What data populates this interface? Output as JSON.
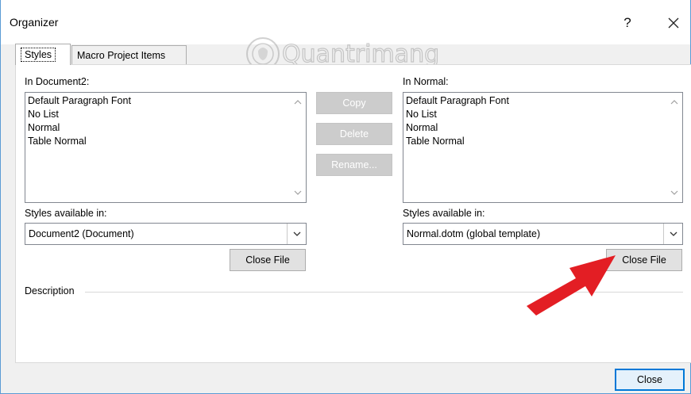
{
  "window": {
    "title": "Organizer",
    "help_glyph": "?",
    "close_glyph": "✕"
  },
  "tabs": [
    {
      "label": "Styles",
      "active": true
    },
    {
      "label": "Macro Project Items",
      "active": false
    }
  ],
  "left": {
    "label": "In Document2:",
    "items": [
      "Default Paragraph Font",
      "No List",
      "Normal",
      "Table Normal"
    ],
    "available_label": "Styles available in:",
    "available_value": "Document2 (Document)",
    "close_file_label": "Close File"
  },
  "right": {
    "label": "In Normal:",
    "items": [
      "Default Paragraph Font",
      "No List",
      "Normal",
      "Table Normal"
    ],
    "available_label": "Styles available in:",
    "available_value": "Normal.dotm (global template)",
    "close_file_label": "Close File"
  },
  "actions": {
    "copy_label": "Copy",
    "delete_label": "Delete",
    "rename_label": "Rename..."
  },
  "description_label": "Description",
  "footer": {
    "close_label": "Close"
  },
  "watermark_text": "Quantrimang",
  "colors": {
    "accent": "#0078d7",
    "window_border": "#5b9bd5",
    "arrow": "#e31e24",
    "disabled_button": "#cccccc"
  }
}
